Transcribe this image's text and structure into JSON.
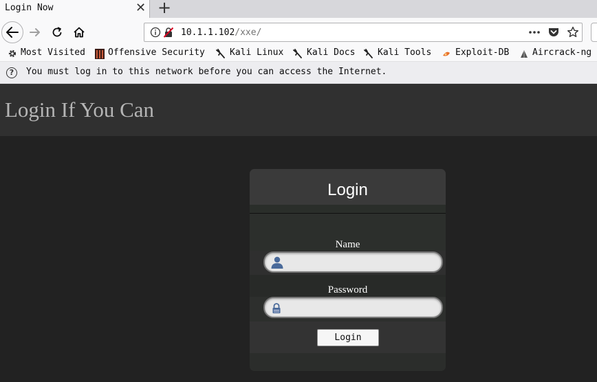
{
  "browser": {
    "tab": {
      "title": "Login Now",
      "close_glyph": "✕"
    },
    "new_tab_glyph": "+",
    "url": {
      "host": "10.1.1.102",
      "path": "/xxe/"
    },
    "bookmarks": [
      {
        "label": "Most Visited",
        "icon": "gear-icon"
      },
      {
        "label": "Offensive Security",
        "icon": "offsec-icon"
      },
      {
        "label": "Kali Linux",
        "icon": "kali-dragon-icon"
      },
      {
        "label": "Kali Docs",
        "icon": "kali-dragon-icon"
      },
      {
        "label": "Kali Tools",
        "icon": "kali-dragon-icon"
      },
      {
        "label": "Exploit-DB",
        "icon": "exploitdb-icon"
      },
      {
        "label": "Aircrack-ng",
        "icon": "aircrack-icon"
      }
    ],
    "notice": {
      "icon_glyph": "?",
      "text": "You must log in to this network before you can access the Internet."
    }
  },
  "page": {
    "title": "Login If You Can",
    "card": {
      "title": "Login",
      "name_label": "Name",
      "password_label": "Password",
      "submit_label": "Login",
      "name_value": "",
      "password_value": ""
    }
  },
  "colors": {
    "page_bg": "#222222",
    "header_bg": "#303030",
    "card_bg": "#2f2f2f",
    "title_text": "#b5b5b5",
    "icon_blue": "#4a6a9a"
  }
}
